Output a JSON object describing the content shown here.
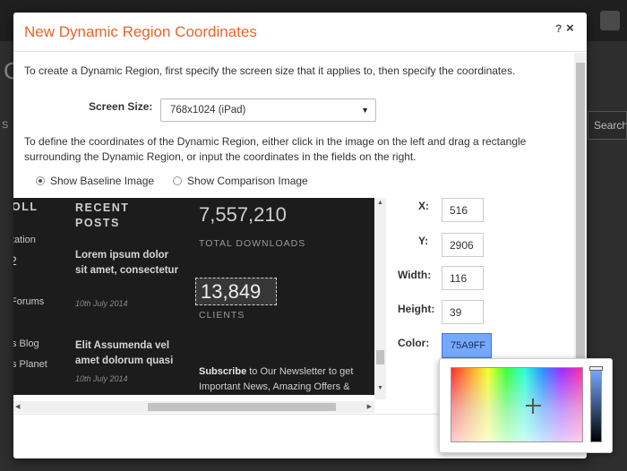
{
  "background": {
    "letter": "C",
    "side_letter": "S",
    "search_text": "Search"
  },
  "modal": {
    "title": "New Dynamic Region Coordinates",
    "help_label": "?",
    "close_label": "×",
    "intro": "To create a Dynamic Region, first specify the screen size that it applies to, then specify the coordinates.",
    "screen_size_label": "Screen Size:",
    "screen_size_value": "768x1024 (iPad)",
    "define_text": "To define the coordinates of the Dynamic Region, either click in the image on the left and drag a rectangle surrounding the Dynamic Region, or input the coordinates in the fields on the right.",
    "radio_baseline": "Show Baseline Image",
    "radio_comparison": "Show Comparison Image"
  },
  "preview": {
    "col1_heading": "OLL",
    "col1_items": [
      "tation",
      "2",
      "Forums",
      "s Blog",
      "s Planet"
    ],
    "recent_posts_heading": "RECENT\nPOSTS",
    "post1_title": "Lorem ipsum dolor sit amet, consectetur",
    "post1_date": "10th July 2014",
    "post2_title": "Elit Assumenda vel amet dolorum quasi",
    "post2_date": "10th July 2014",
    "downloads_value": "7,557,210",
    "downloads_caption": "TOTAL DOWNLOADS",
    "clients_value": "13,849",
    "clients_caption": "CLIENTS",
    "subscribe_bold": "Subscribe",
    "subscribe_text": " to Our Newsletter to get Important News, Amazing Offers & Inside Scoops:"
  },
  "coords": {
    "x_label": "X:",
    "x_value": "516",
    "y_label": "Y:",
    "y_value": "2906",
    "width_label": "Width:",
    "width_value": "116",
    "height_label": "Height:",
    "height_value": "39",
    "color_label": "Color:",
    "color_value": "75A9FF"
  },
  "colors": {
    "accent": "#e8622b",
    "selected_color": "#75a9ff"
  }
}
